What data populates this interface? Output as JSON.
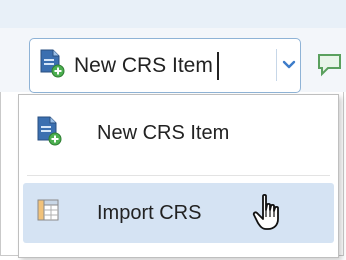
{
  "toolbar": {
    "new_item_label": "New CRS Item",
    "dropdown_icon": "chevron-down-icon",
    "doc_icon": "new-document-icon",
    "next_icon": "comment-icon"
  },
  "menu": {
    "items": [
      {
        "label": "New CRS Item",
        "icon": "new-document-icon"
      },
      {
        "label": "Import CRS",
        "icon": "import-table-icon"
      }
    ]
  },
  "colors": {
    "accent_border": "#8fb3d6",
    "hover_row": "#d5e3f3",
    "doc_icon_blue": "#3b6fb0",
    "plus_green": "#4caf50"
  }
}
